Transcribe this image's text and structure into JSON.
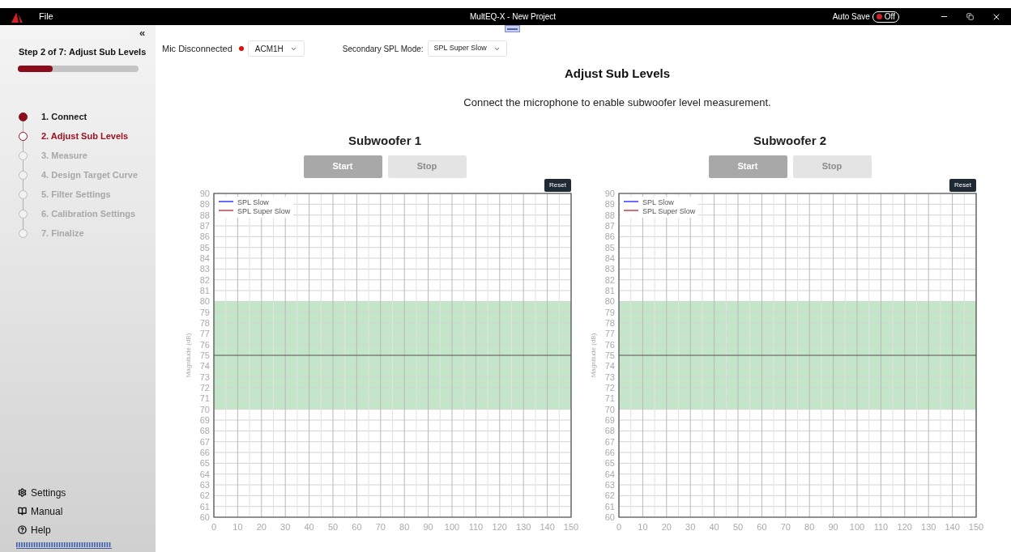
{
  "title_bar": {
    "menu": "File",
    "title": "MultEQ-X - New Project",
    "auto_save": {
      "label": "Auto Save",
      "on": false,
      "state_text": "Off"
    }
  },
  "sidebar": {
    "collapse": "«",
    "step_title": "Step 2 of 7: Adjust Sub Levels",
    "progress": {
      "level": 0.29
    },
    "steps": [
      {
        "label": "1. Connect",
        "completed": true,
        "selected": false
      },
      {
        "label": "2. Adjust Sub Levels",
        "completed": false,
        "selected": true
      },
      {
        "label": "3. Measure",
        "completed": false,
        "selected": false
      },
      {
        "label": "4. Design Target Curve",
        "completed": false,
        "selected": false
      },
      {
        "label": "5. Filter Settings",
        "completed": false,
        "selected": false
      },
      {
        "label": "6. Calibration Settings",
        "completed": false,
        "selected": false
      },
      {
        "label": "7. Finalize",
        "completed": false,
        "selected": false
      }
    ],
    "links": [
      {
        "label": "Settings",
        "kind": "settings"
      },
      {
        "label": "Manual",
        "kind": "manual"
      },
      {
        "label": "Help",
        "kind": "help"
      }
    ]
  },
  "toolbar": {
    "mic_status": "Mic Disconnected",
    "mic_connected": false,
    "mic_select": "ACM1H",
    "mode_label": "Secondary SPL Mode:",
    "mode_select": "SPL Super Slow"
  },
  "heading": "Adjust Sub Levels",
  "message": "Connect the microphone to enable subwoofer level measurement.",
  "subwoofers": [
    {
      "title": "Subwoofer 1",
      "buttons": [
        {
          "label": "Start",
          "disabled": false
        },
        {
          "label": "Stop",
          "disabled": true
        }
      ],
      "reset": "Reset",
      "chart_data": {
        "type": "line",
        "ylabel": "Magnitude (dB)",
        "grid": true,
        "categories": [
          "0",
          "10",
          "20",
          "30",
          "40",
          "50",
          "60",
          "70",
          "80",
          "90",
          "100",
          "110",
          "120",
          "130",
          "140",
          "150"
        ],
        "series": [
          {
            "name": "SPL Slow",
            "color": "#1a1aff",
            "values": [
              null,
              null,
              null,
              null,
              null,
              null,
              null,
              null,
              null,
              null,
              null,
              null,
              null,
              null,
              null,
              null
            ]
          },
          {
            "name": "SPL Super Slow",
            "color": "#c0202a",
            "values": [
              null,
              null,
              null,
              null,
              null,
              null,
              null,
              null,
              null,
              null,
              null,
              null,
              null,
              null,
              null,
              null
            ]
          }
        ],
        "ylim": [
          60,
          90
        ],
        "yticks": [
          60,
          61,
          62,
          63,
          64,
          65,
          66,
          67,
          68,
          69,
          70,
          71,
          72,
          73,
          74,
          75,
          76,
          77,
          78,
          79,
          80,
          81,
          82,
          83,
          84,
          85,
          86,
          87,
          88,
          89,
          90
        ],
        "bands": [
          {
            "axis": "y",
            "from": 70,
            "to": 80,
            "color": "#c3e6c9"
          }
        ],
        "ref_lines": [
          {
            "axis": "y",
            "value": 75,
            "color": "#555555"
          }
        ]
      }
    },
    {
      "title": "Subwoofer 2",
      "buttons": [
        {
          "label": "Start",
          "disabled": false
        },
        {
          "label": "Stop",
          "disabled": true
        }
      ],
      "reset": "Reset",
      "chart_data": {
        "type": "line",
        "ylabel": "Magnitude (dB)",
        "grid": true,
        "categories": [
          "0",
          "10",
          "20",
          "30",
          "40",
          "50",
          "60",
          "70",
          "80",
          "90",
          "100",
          "110",
          "120",
          "130",
          "140",
          "150"
        ],
        "series": [
          {
            "name": "SPL Slow",
            "color": "#1a1aff",
            "values": [
              null,
              null,
              null,
              null,
              null,
              null,
              null,
              null,
              null,
              null,
              null,
              null,
              null,
              null,
              null,
              null
            ]
          },
          {
            "name": "SPL Super Slow",
            "color": "#c0202a",
            "values": [
              null,
              null,
              null,
              null,
              null,
              null,
              null,
              null,
              null,
              null,
              null,
              null,
              null,
              null,
              null,
              null
            ]
          }
        ],
        "ylim": [
          60,
          90
        ],
        "yticks": [
          60,
          61,
          62,
          63,
          64,
          65,
          66,
          67,
          68,
          69,
          70,
          71,
          72,
          73,
          74,
          75,
          76,
          77,
          78,
          79,
          80,
          81,
          82,
          83,
          84,
          85,
          86,
          87,
          88,
          89,
          90
        ],
        "bands": [
          {
            "axis": "y",
            "from": 70,
            "to": 80,
            "color": "#c3e6c9"
          }
        ],
        "ref_lines": [
          {
            "axis": "y",
            "value": 75,
            "color": "#555555"
          }
        ]
      }
    }
  ]
}
